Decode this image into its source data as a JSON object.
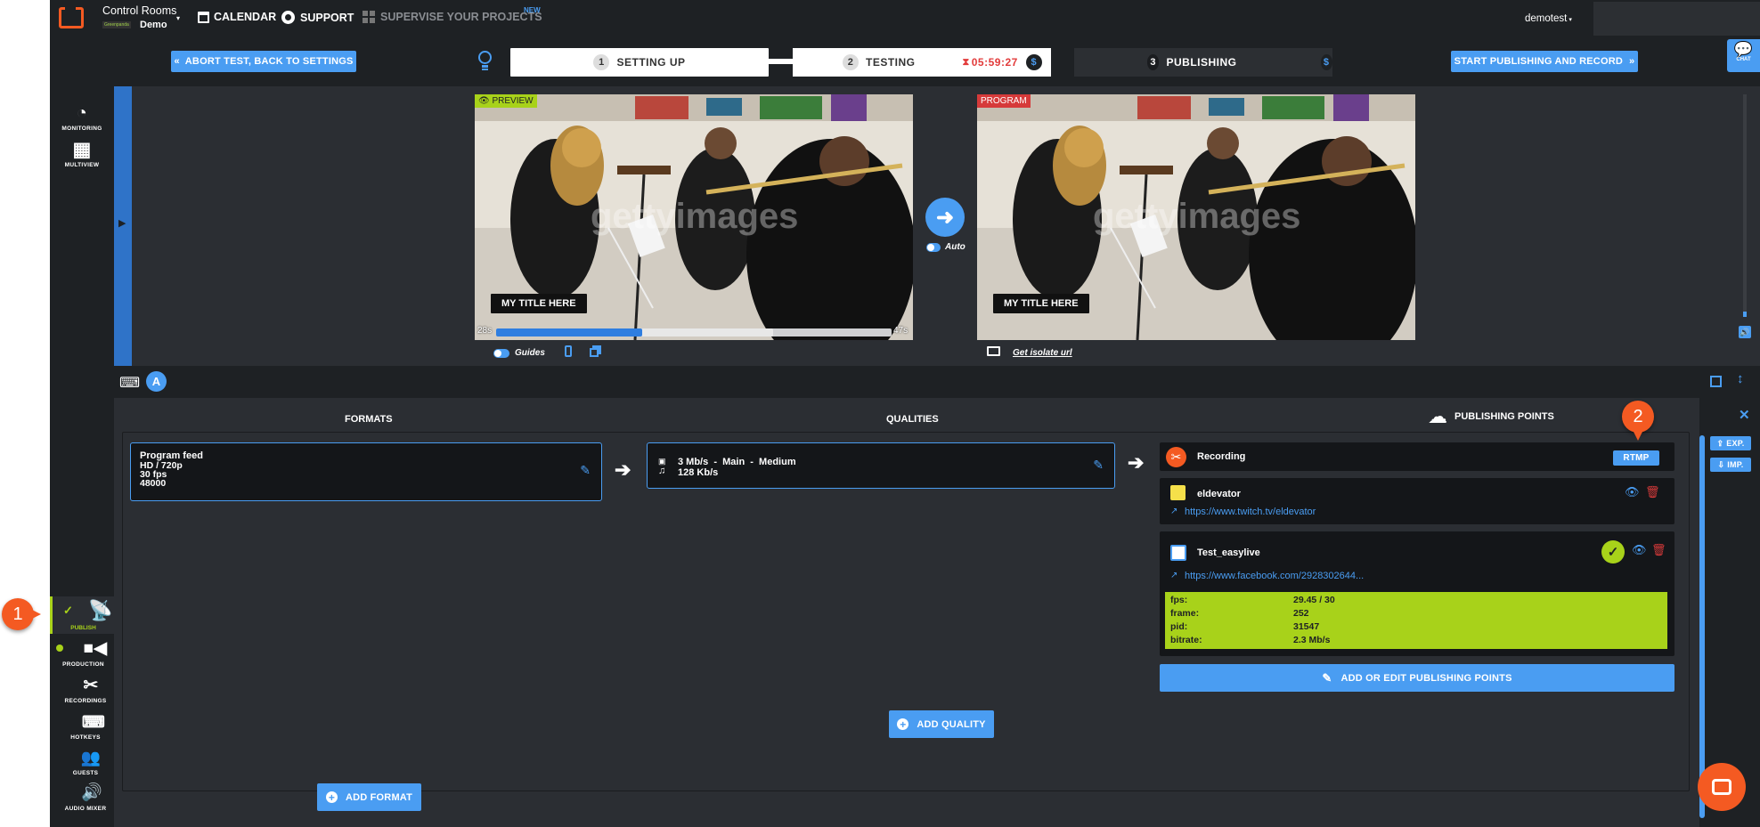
{
  "topbar": {
    "app_title": "Control Rooms",
    "sub_brand": "Greenpanda",
    "room_name": "Demo",
    "nav": {
      "calendar": "CALENDAR",
      "support": "SUPPORT",
      "supervise": "SUPERVISE YOUR PROJECTS",
      "new_badge": "NEW"
    },
    "user": "demotest"
  },
  "steps": {
    "abort_label": "ABORT TEST, BACK TO SETTINGS",
    "step1": {
      "num": "1",
      "label": "SETTING UP"
    },
    "step2": {
      "num": "2",
      "label": "TESTING",
      "timer": "05:59:27"
    },
    "step3": {
      "num": "3",
      "label": "PUBLISHING"
    },
    "currency_symbol": "$",
    "start_label": "START PUBLISHING AND RECORD",
    "chat_label": "CHAT"
  },
  "rail": {
    "monitoring": "MONITORING",
    "multiview": "MULTIVIEW",
    "publish": "PUBLISH",
    "production": "PRODUCTION",
    "recordings": "RECORDINGS",
    "hotkeys": "HOTKEYS",
    "guests": "GUESTS",
    "audio_mixer": "AUDIO MIXER"
  },
  "preview": {
    "preview_label": "PREVIEW",
    "program_label": "PROGRAM",
    "title_overlay": "MY TITLE HERE",
    "watermark": "gettyimages",
    "time_start": "28s",
    "time_end": "47s",
    "progress_fraction": 0.37,
    "buffered_fraction": 0.7,
    "auto_label": "Auto",
    "guides_label": "Guides",
    "isolate_label": "Get isolate url"
  },
  "toolbar": {
    "avatar_letter": "A"
  },
  "columns": {
    "formats": "FORMATS",
    "qualities": "QUALITIES",
    "publishing_points": "PUBLISHING POINTS"
  },
  "format_card": {
    "line1": "Program feed",
    "line2": "HD / 720p",
    "line3": "30 fps",
    "line4": "48000"
  },
  "quality_card": {
    "video": "3 Mb/s  -  Main  -  Medium",
    "audio": "128 Kb/s"
  },
  "publishing": {
    "recording_label": "Recording",
    "rtmp_label": "RTMP",
    "points": [
      {
        "name": "eldevator",
        "url": "https://www.twitch.tv/eldevator"
      },
      {
        "name": "Test_easylive",
        "url": "https://www.facebook.com/2928302644..."
      }
    ],
    "stats": [
      {
        "key": "fps:",
        "value": "29.45 / 30"
      },
      {
        "key": "frame:",
        "value": "252"
      },
      {
        "key": "pid:",
        "value": "31547"
      },
      {
        "key": "bitrate:",
        "value": "2.3 Mb/s"
      }
    ],
    "add_edit_label": "ADD OR EDIT PUBLISHING POINTS"
  },
  "buttons": {
    "add_quality": "ADD QUALITY",
    "add_format": "ADD FORMAT"
  },
  "rightcol": {
    "exp": "EXP.",
    "imp": "IMP."
  },
  "callouts": {
    "one": "1",
    "two": "2"
  },
  "colors": {
    "accent": "#4a9df2",
    "bg": "#2b2e33",
    "bar": "#1e2124",
    "stats_green": "#a8d21a",
    "alert_orange": "#f45a22",
    "timer_red": "#e23b3b"
  }
}
